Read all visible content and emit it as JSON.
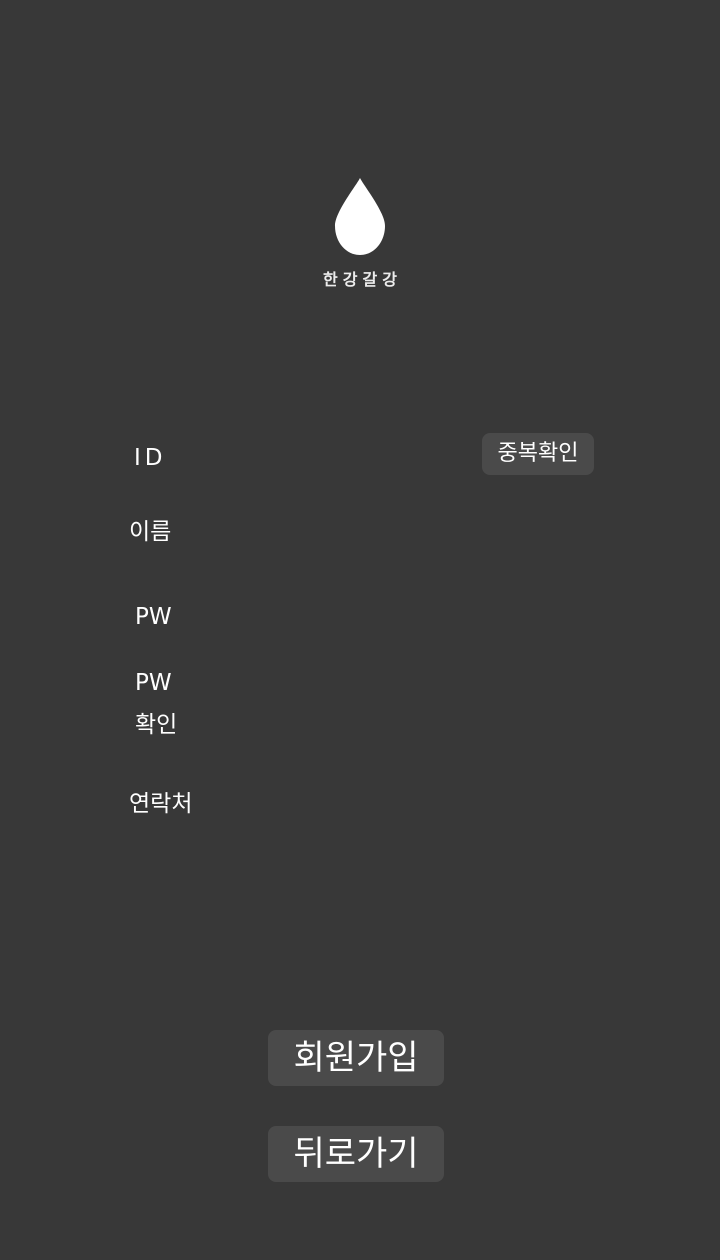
{
  "logo": {
    "icon": "water-drop-icon",
    "brand_text": "한강갈강"
  },
  "form": {
    "id_label": "ID",
    "name_label": "이름",
    "pw_label": "PW",
    "pw_confirm_label_line1": "PW",
    "pw_confirm_label_line2": "확인",
    "contact_label": "연락처",
    "id_value": "",
    "name_value": "",
    "pw_value": "",
    "pw_confirm_value": "",
    "contact_value": "",
    "duplicate_check_label": "중복확인"
  },
  "actions": {
    "signup_label": "회원가입",
    "back_label": "뒤로가기"
  },
  "colors": {
    "background": "#383838",
    "button": "#4a4a4a",
    "text": "#ffffff"
  }
}
